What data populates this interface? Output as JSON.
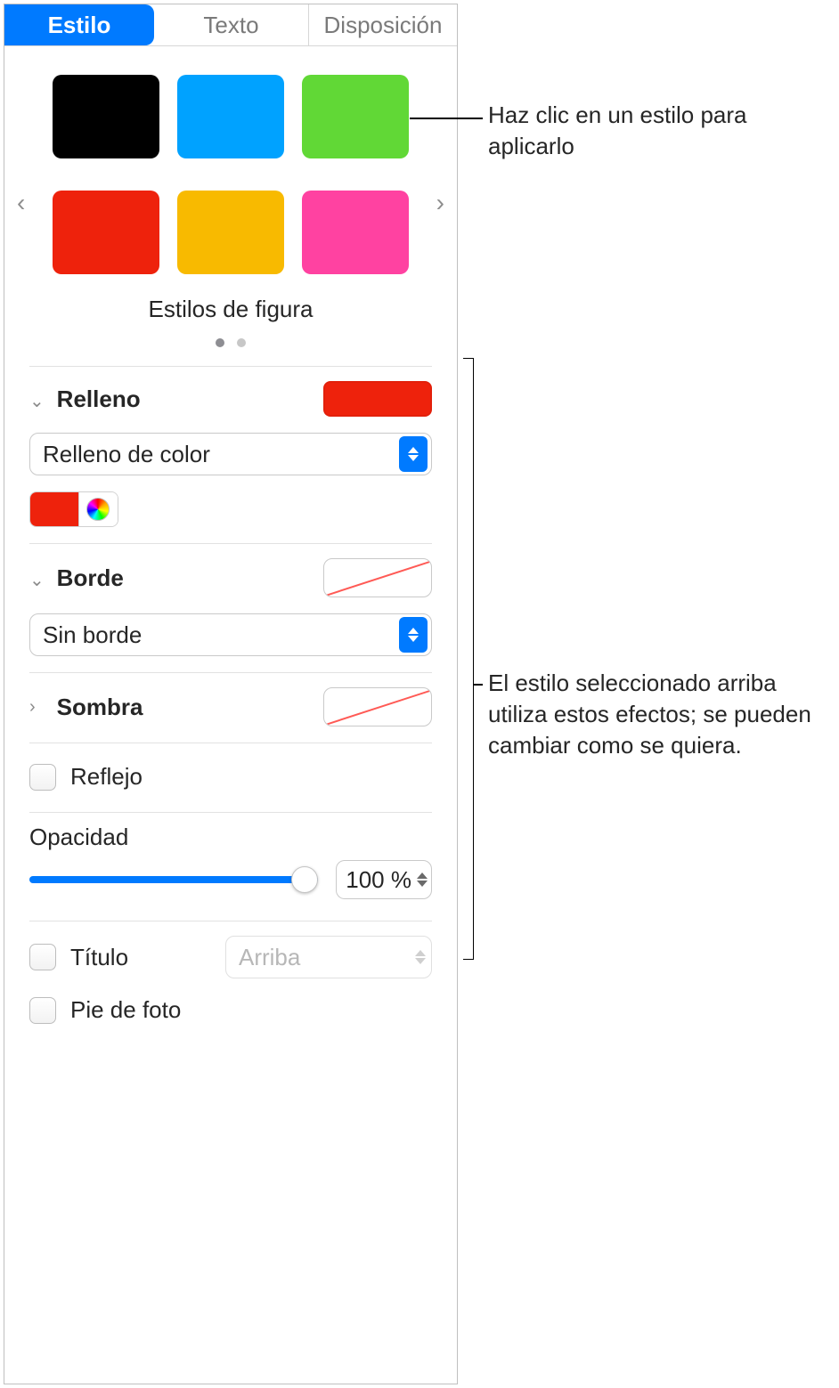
{
  "tabs": {
    "style": "Estilo",
    "text": "Texto",
    "layout": "Disposición"
  },
  "styles": {
    "caption": "Estilos de figura",
    "swatches": [
      "#000000",
      "#00a2ff",
      "#61d836",
      "#ee220c",
      "#f8ba00",
      "#ff42a1"
    ]
  },
  "fill": {
    "label": "Relleno",
    "type": "Relleno de color",
    "color": "#ee220c"
  },
  "border": {
    "label": "Borde",
    "type": "Sin borde"
  },
  "shadow": {
    "label": "Sombra"
  },
  "reflection": {
    "label": "Reflejo"
  },
  "opacity": {
    "label": "Opacidad",
    "value_text": "100 %",
    "value": 100
  },
  "title": {
    "label": "Título",
    "position": "Arriba"
  },
  "caption": {
    "label": "Pie de foto"
  },
  "callouts": {
    "a": "Haz clic en un estilo para aplicarlo",
    "b": "El estilo seleccionado arriba utiliza estos efectos; se pueden cambiar como se quiera."
  }
}
